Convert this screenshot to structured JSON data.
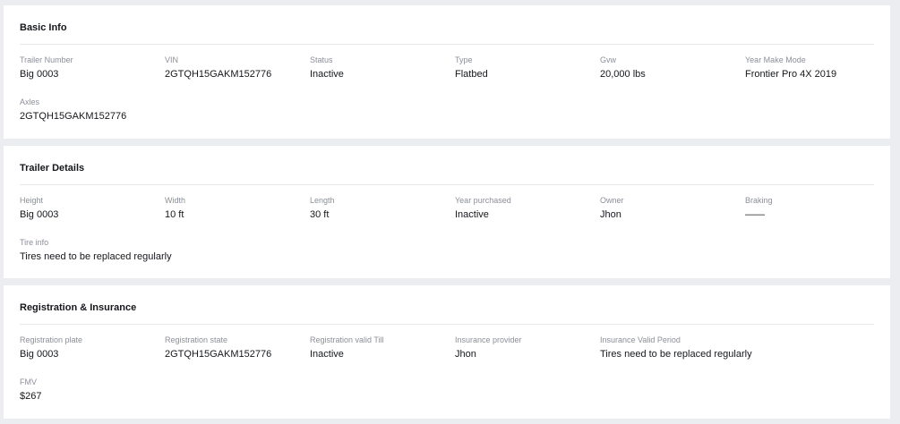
{
  "basic_info": {
    "title": "Basic Info",
    "fields": [
      {
        "label": "Trailer Number",
        "value": "Big 0003"
      },
      {
        "label": "VIN",
        "value": "2GTQH15GAKM152776"
      },
      {
        "label": "Status",
        "value": "Inactive"
      },
      {
        "label": "Type",
        "value": "Flatbed"
      },
      {
        "label": "Gvw",
        "value": "20,000 lbs"
      },
      {
        "label": "Year Make Mode",
        "value": "Frontier Pro 4X 2019"
      },
      {
        "label": "Axles",
        "value": "2GTQH15GAKM152776"
      }
    ]
  },
  "trailer_details": {
    "title": "Trailer Details",
    "fields": [
      {
        "label": "Height",
        "value": "Big 0003"
      },
      {
        "label": "Width",
        "value": "10 ft"
      },
      {
        "label": "Length",
        "value": "30 ft"
      },
      {
        "label": "Year purchased",
        "value": "Inactive"
      },
      {
        "label": "Owner",
        "value": "Jhon"
      },
      {
        "label": "Braking",
        "value": "——"
      },
      {
        "label": "Tire info",
        "value": "Tires need to be replaced regularly"
      }
    ]
  },
  "registration_insurance": {
    "title": "Registration & Insurance",
    "fields": [
      {
        "label": "Registration plate",
        "value": "Big 0003"
      },
      {
        "label": "Registration state",
        "value": "2GTQH15GAKM152776"
      },
      {
        "label": "Registration valid Till",
        "value": "Inactive"
      },
      {
        "label": "Insurance provider",
        "value": "Jhon"
      },
      {
        "label": "Insurance Valid Period",
        "value": "Tires need to be replaced regularly"
      },
      {
        "label": "FMV",
        "value": "$267"
      }
    ]
  }
}
